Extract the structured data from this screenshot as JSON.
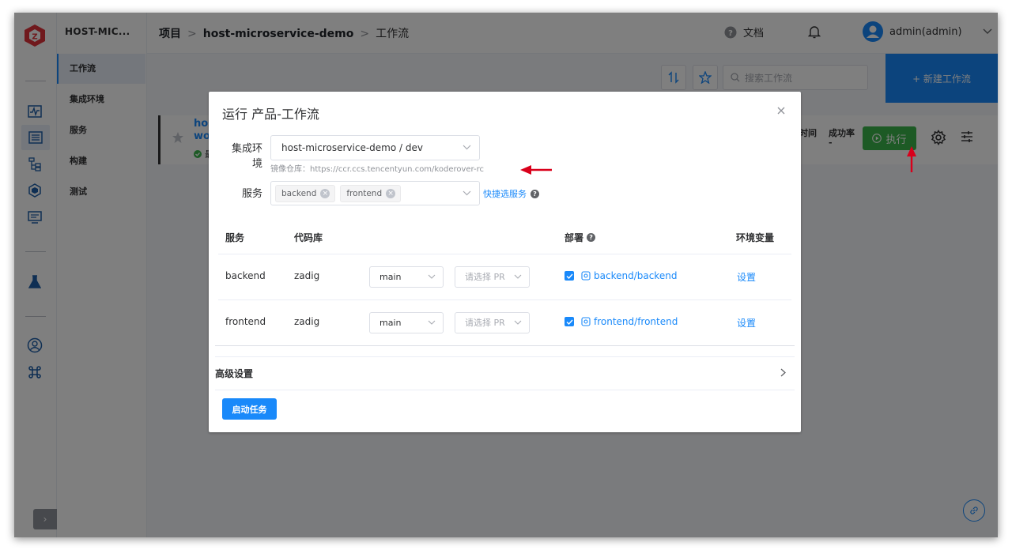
{
  "sidebar": {
    "project": "HOST-MIC...",
    "items": [
      {
        "label": "工作流"
      },
      {
        "label": "集成环境"
      },
      {
        "label": "服务"
      },
      {
        "label": "构建"
      },
      {
        "label": "测试"
      }
    ],
    "rail_icons": [
      "logo-icon",
      "pulse-icon",
      "project-list-icon",
      "hierarchy-icon",
      "cube-icon",
      "monitor-icon",
      "flask-icon",
      "user-circle-icon",
      "command-icon"
    ]
  },
  "header": {
    "breadcrumb": {
      "root": "项目",
      "project": "host-microservice-demo",
      "current": "工作流"
    },
    "docs_label": "文档",
    "user": "admin(admin)"
  },
  "toolbar": {
    "search_placeholder": "搜索工作流",
    "new_workflow": "+ 新建工作流"
  },
  "workflow_card": {
    "name_line1": "hos",
    "name_line2": "wor",
    "status": "最",
    "col_time": "时间",
    "col_success": "成功率",
    "success_value": "-",
    "run_label": "执行"
  },
  "modal": {
    "title": "运行 产品-工作流",
    "env_label": "集成环境",
    "env_value": "host-microservice-demo / dev",
    "registry_hint": "镜像仓库：https://ccr.ccs.tencentyun.com/koderover-rc",
    "service_label": "服务",
    "service_tags": [
      "backend",
      "frontend"
    ],
    "quick_select": "快捷选服务",
    "table": {
      "headers": {
        "service": "服务",
        "repo": "代码库",
        "deploy": "部署",
        "env_vars": "环境变量"
      },
      "rows": [
        {
          "service": "backend",
          "repo": "zadig",
          "branch": "main",
          "pr_placeholder": "请选择 PR",
          "deploy": "backend/backend",
          "settings": "设置"
        },
        {
          "service": "frontend",
          "repo": "zadig",
          "branch": "main",
          "pr_placeholder": "请选择 PR",
          "deploy": "frontend/frontend",
          "settings": "设置"
        }
      ]
    },
    "advanced": "高级设置",
    "start": "启动任务"
  },
  "colors": {
    "primary": "#1989fa",
    "run_green": "#3ab54a",
    "annotation_red": "#d9001b"
  }
}
